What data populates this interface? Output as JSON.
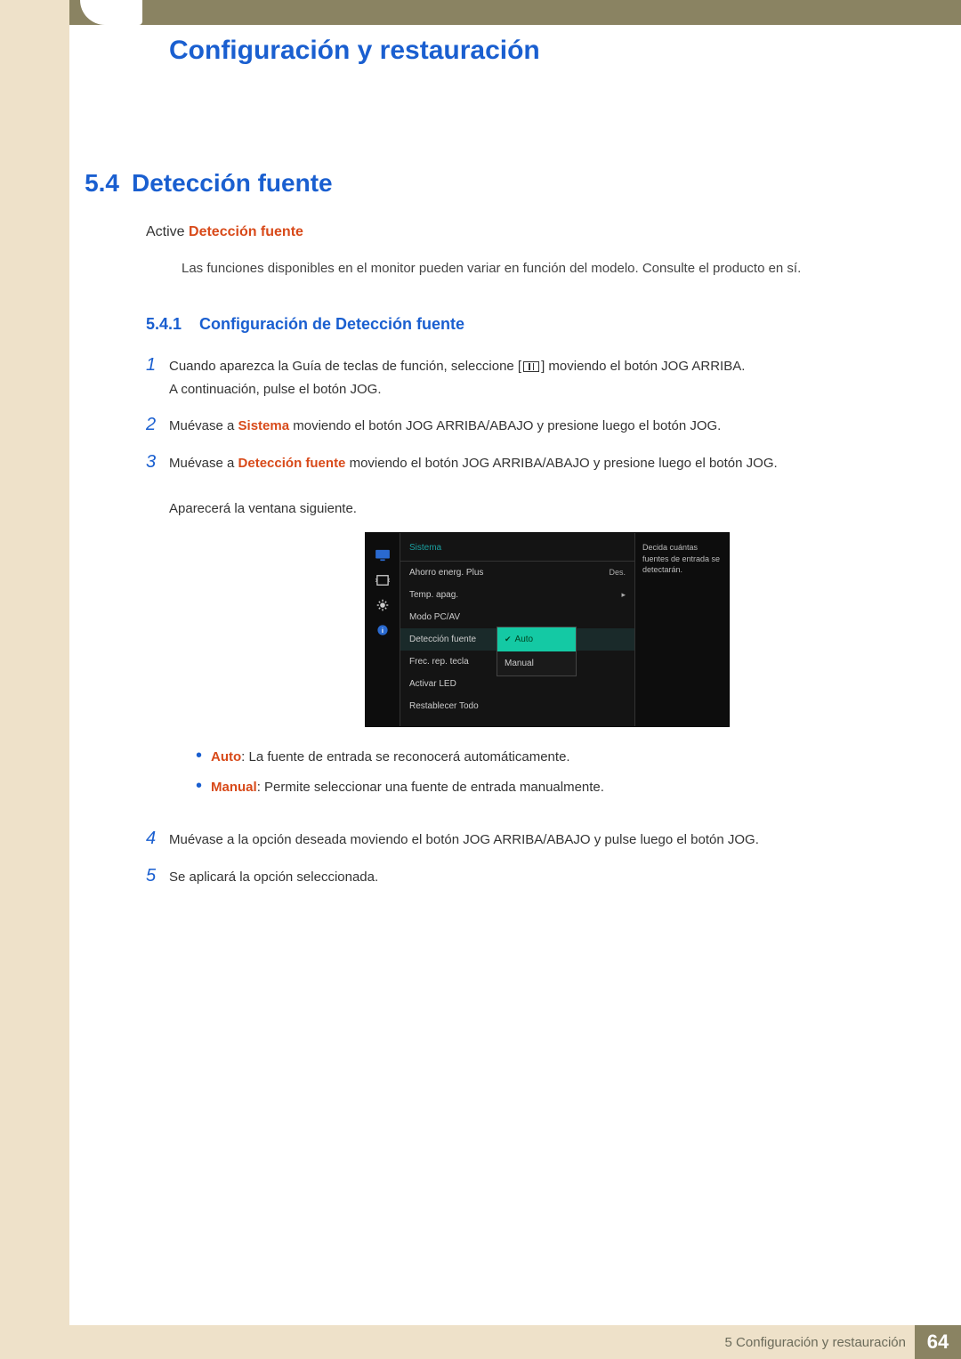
{
  "chapter_title": "Configuración y restauración",
  "section": {
    "num": "5.4",
    "title": "Detección fuente"
  },
  "intro": {
    "prefix": "Active ",
    "hl": "Detección fuente"
  },
  "note": "Las funciones disponibles en el monitor pueden variar en función del modelo. Consulte el producto en sí.",
  "subsection": {
    "num": "5.4.1",
    "title": "Configuración de Detección fuente"
  },
  "steps": {
    "s1": {
      "a": "Cuando aparezca la Guía de teclas de función, seleccione [",
      "b": "] moviendo el botón JOG ARRIBA.",
      "c": "A continuación, pulse el botón JOG."
    },
    "s2": {
      "a": "Muévase a ",
      "hl": "Sistema",
      "b": " moviendo el botón JOG ARRIBA/ABAJO y presione luego el botón JOG."
    },
    "s3": {
      "a": "Muévase a ",
      "hl": "Detección fuente",
      "b": " moviendo el botón JOG ARRIBA/ABAJO y presione luego el botón JOG.",
      "c": "Aparecerá la ventana siguiente."
    },
    "s4": "Muévase a la opción deseada moviendo el botón JOG ARRIBA/ABAJO y pulse luego el botón JOG.",
    "s5": "Se aplicará la opción seleccionada."
  },
  "bullets": {
    "b1": {
      "hl": "Auto",
      "text": ": La fuente de entrada se reconocerá automáticamente."
    },
    "b2": {
      "hl": "Manual",
      "text": ": Permite seleccionar una fuente de entrada manualmente."
    }
  },
  "osd": {
    "header": "Sistema",
    "rows": {
      "r1": {
        "label": "Ahorro energ. Plus",
        "val": "Des."
      },
      "r2": {
        "label": "Temp. apag.",
        "val": "▸"
      },
      "r3": {
        "label": "Modo PC/AV"
      },
      "r4": {
        "label": "Detección fuente"
      },
      "r5": {
        "label": "Frec. rep. tecla"
      },
      "r6": {
        "label": "Activar LED"
      },
      "r7": {
        "label": "Restablecer Todo"
      }
    },
    "popup": {
      "opt1": "Auto",
      "opt2": "Manual"
    },
    "help": "Decida cuántas fuentes de entrada se detectarán."
  },
  "footer": {
    "text": "5 Configuración y restauración",
    "page": "64"
  }
}
